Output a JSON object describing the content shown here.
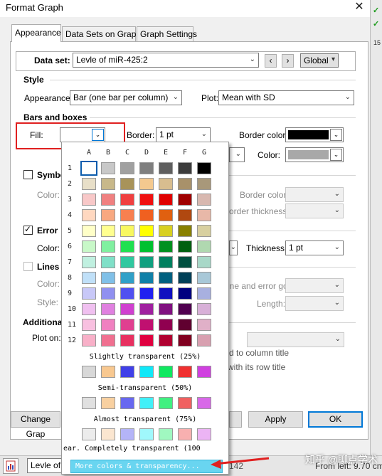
{
  "window": {
    "title": "Format Graph",
    "close_glyph": "✕"
  },
  "tabs": [
    "Appearance",
    "Data Sets on Graph",
    "Graph Settings"
  ],
  "dataset": {
    "label": "Data set:",
    "value": "Levle of miR-425:2",
    "scope": "Global"
  },
  "style": {
    "heading": "Style",
    "appearance_label": "Appearance:",
    "appearance_value": "Bar (one bar per column)",
    "plot_label": "Plot:",
    "plot_value": "Mean with SD"
  },
  "bars": {
    "heading": "Bars and boxes",
    "fill_label": "Fill:",
    "border_label": "Border:",
    "border_value": "1 pt",
    "border_color_label": "Border color:",
    "color_label": "Color:"
  },
  "symbols": {
    "label": "Symbo",
    "color_label": "Color:",
    "border_color_label": "Border color:",
    "border_thickness_label": "order thickness:"
  },
  "errorbars": {
    "label": "Error",
    "color_label": "Color:",
    "thickness_label": "Thickness:",
    "thickness_value": "1 pt"
  },
  "lines": {
    "label": "Lines",
    "color_label": "Color:",
    "style_label": "Style:",
    "error_go_label": "ine and error go:",
    "length_label": "Length:"
  },
  "additional": {
    "label": "Additiona",
    "plot_on_label": "Plot on:",
    "col_title_text": "d to column title",
    "row_title_text": "with its row title"
  },
  "buttons": {
    "change_graph": "Change Grap",
    "apply": "Apply",
    "ok": "OK"
  },
  "colors": {
    "black": "#000000",
    "gray_border": "#a8a8a8",
    "accent_blue": "#0078d7",
    "highlight_red": "#e02020",
    "more_button": "#69d5f0"
  },
  "palette": {
    "columns": [
      "A",
      "B",
      "C",
      "D",
      "E",
      "F",
      "G"
    ],
    "rows": [
      {
        "n": "1",
        "colors": [
          "#ffffff",
          "#c8c8c8",
          "#a0a0a0",
          "#7f7f7f",
          "#5f5f5f",
          "#3c3c3c",
          "#000000"
        ]
      },
      {
        "n": "2",
        "colors": [
          "#e8dfc8",
          "#c8b88a",
          "#a8935a",
          "#f4c98f",
          "#d8bd8f",
          "#a8916a",
          "#a8987a"
        ]
      },
      {
        "n": "3",
        "colors": [
          "#f8c8c8",
          "#f08080",
          "#f04040",
          "#f01010",
          "#e00000",
          "#a00000",
          "#d8b8b0"
        ]
      },
      {
        "n": "4",
        "colors": [
          "#ffd8c0",
          "#f8a880",
          "#f88050",
          "#f06020",
          "#e06010",
          "#b04810",
          "#e8b8a8"
        ]
      },
      {
        "n": "5",
        "colors": [
          "#ffffc8",
          "#ffff90",
          "#f8f860",
          "#ffff00",
          "#d8d020",
          "#888000",
          "#d8d0a0"
        ]
      },
      {
        "n": "6",
        "colors": [
          "#c8f8c8",
          "#80f0a0",
          "#20e050",
          "#00c030",
          "#009020",
          "#006010",
          "#b0d8b0"
        ]
      },
      {
        "n": "7",
        "colors": [
          "#c0f0e0",
          "#80e0c8",
          "#30c8a0",
          "#10a080",
          "#008060",
          "#005040",
          "#a8d8c8"
        ]
      },
      {
        "n": "8",
        "colors": [
          "#c0e0f8",
          "#80c0e8",
          "#30a0c8",
          "#1080a8",
          "#006080",
          "#004058",
          "#a8c8d8"
        ]
      },
      {
        "n": "9",
        "colors": [
          "#c8c8f8",
          "#9090f0",
          "#5050f0",
          "#2020f0",
          "#1010c0",
          "#000080",
          "#a8b0e0"
        ]
      },
      {
        "n": "10",
        "colors": [
          "#f0c0f0",
          "#e080e0",
          "#d040d0",
          "#a020a0",
          "#801080",
          "#500050",
          "#d8b0d8"
        ]
      },
      {
        "n": "11",
        "colors": [
          "#f8c0e0",
          "#f080c0",
          "#e04090",
          "#c01070",
          "#900050",
          "#600030",
          "#e0b0c8"
        ]
      },
      {
        "n": "12",
        "colors": [
          "#f8b0c8",
          "#f07090",
          "#e83060",
          "#e00040",
          "#b00030",
          "#800020",
          "#d8a0b0"
        ]
      }
    ],
    "transparent_sections": [
      {
        "label": "Slightly transparent (25%)",
        "colors": [
          "#d8d8d8",
          "#f8c890",
          "#4040e8",
          "#10e8f8",
          "#10e860",
          "#f03030",
          "#d040e0"
        ]
      },
      {
        "label": "Semi-transparent (50%)",
        "colors": [
          "#e0e0e0",
          "#f8d0a0",
          "#6868f0",
          "#40f0f8",
          "#40f080",
          "#f06060",
          "#d868e8"
        ]
      },
      {
        "label": "Almost transparent (75%)",
        "colors": [
          "#ececec",
          "#fbe6d0",
          "#b4b4f8",
          "#a0f8fc",
          "#a0f8c0",
          "#f8b0b0",
          "#ecb4f4"
        ]
      }
    ],
    "completely_transparent_label": "ear. Completely transparent (100",
    "more_label": "More colors & transparency..."
  },
  "bottom": {
    "left_text": "Levle of",
    "mid_text": "142",
    "right_text": "From left: 9.70 cm."
  },
  "watermark": "知乎 @聊点学术",
  "right_strip": {
    "ruler_text": "15"
  }
}
